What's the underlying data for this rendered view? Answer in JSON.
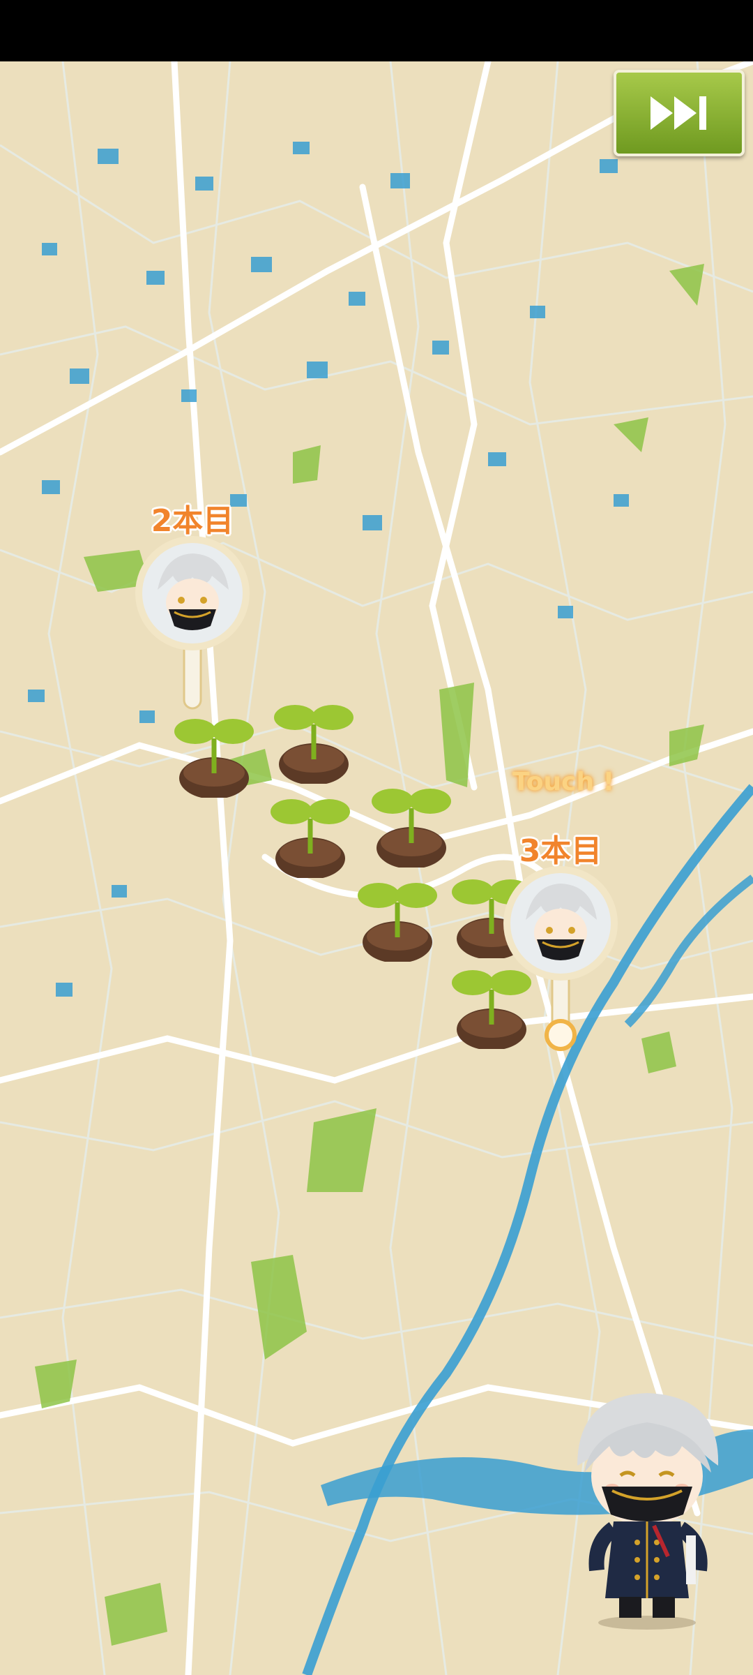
{
  "header": {
    "skip_icon": "fast-forward-skip-icon"
  },
  "map": {
    "colors": {
      "land": "#ecdfbd",
      "water": "#3a9fd1",
      "park": "#8ec448",
      "road": "#ffffff",
      "minor_road": "#d9e3e0"
    }
  },
  "pins": [
    {
      "label": "2本目",
      "icon": "character-portrait-icon",
      "state": "visited"
    },
    {
      "label": "3本目",
      "icon": "character-portrait-icon",
      "state": "current"
    }
  ],
  "hint": {
    "text": "Touch !"
  },
  "sprouts": {
    "count": 7,
    "icon": "sprout-icon"
  },
  "character": {
    "icon": "chibi-character-icon"
  },
  "colors": {
    "accent_orange": "#f1842c",
    "skip_green": "#8cb735",
    "sprout_green": "#9cc733",
    "soil_brown": "#5c3a26"
  }
}
